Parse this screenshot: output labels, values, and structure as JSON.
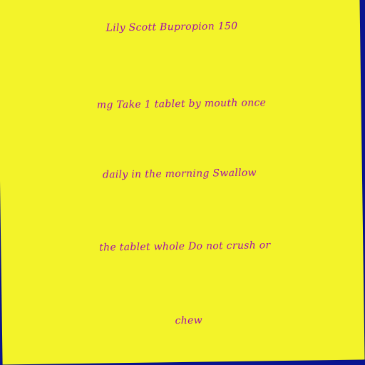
{
  "note": {
    "background_color": "#f3f32a",
    "border_color": "#0a1490",
    "text_color": "#a10fa8",
    "lines": [
      "Lily Scott Bupropion 150",
      "mg Take 1 tablet by mouth once",
      "daily in the morning Swallow",
      "the tablet whole Do not crush or",
      "chew"
    ]
  }
}
